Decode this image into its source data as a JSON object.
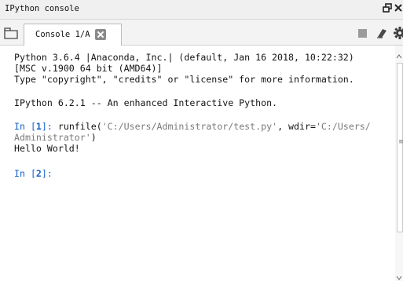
{
  "window": {
    "title": "IPython console"
  },
  "tabs": [
    {
      "label": "Console 1/A",
      "active": true
    }
  ],
  "toolbar": {
    "icons": [
      "browse-tabs-icon",
      "stop-icon",
      "eraser-icon",
      "gear-icon"
    ]
  },
  "console": {
    "banner": [
      "Python 3.6.4 |Anaconda, Inc.| (default, Jan 16 2018, 10:22:32)",
      "[MSC v.1900 64 bit (AMD64)]",
      "Type \"copyright\", \"credits\" or \"license\" for more information.",
      "IPython 6.2.1 -- An enhanced Interactive Python."
    ],
    "cells": [
      {
        "prompt_in": "In [",
        "prompt_num": "1",
        "prompt_end": "]: ",
        "code_func": "runfile(",
        "code_arg1": "'C:/Users/Administrator/test.py'",
        "code_mid": ", wdir=",
        "code_arg2_part1": "'C:/Users/",
        "code_arg2_part2": "Administrator'",
        "code_close": ")",
        "output": "Hello World!"
      },
      {
        "prompt_in": "In [",
        "prompt_num": "2",
        "prompt_end": "]:"
      }
    ]
  },
  "colors": {
    "prompt": "#1560c8",
    "string": "#7a7a7a",
    "text": "#141414"
  }
}
